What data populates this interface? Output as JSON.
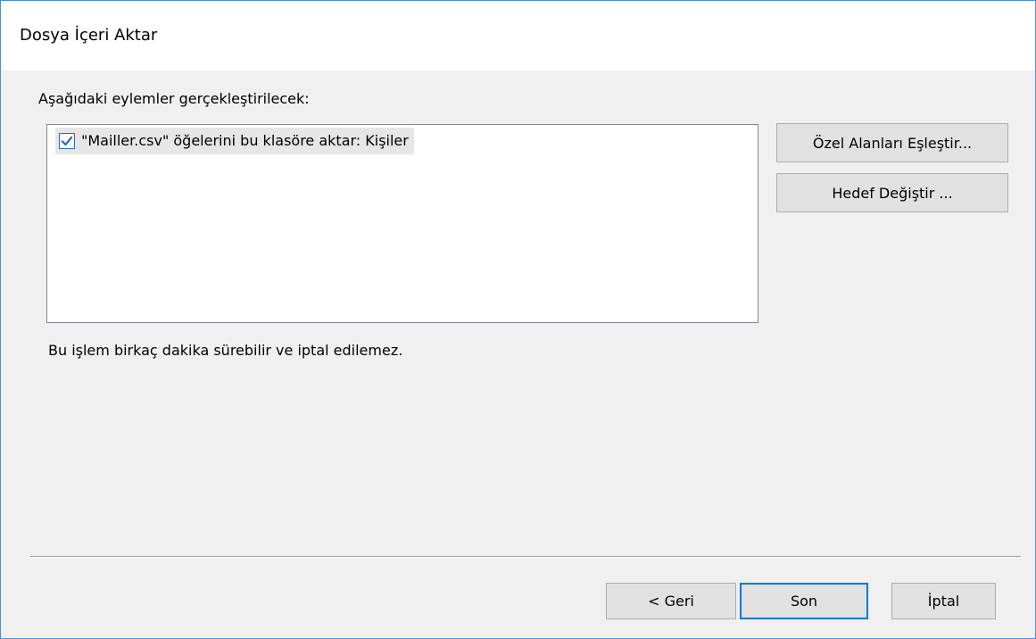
{
  "window": {
    "title": "Dosya İçeri Aktar"
  },
  "actions": {
    "heading": "Aşağıdaki eylemler gerçekleştirilecek:",
    "items": [
      {
        "checked": true,
        "label": "\"Mailler.csv\" öğelerini bu klasöre aktar: Kişiler"
      }
    ]
  },
  "side_buttons": {
    "map_fields_label": "Özel Alanları Eşleştir...",
    "change_target_label": "Hedef Değiştir ..."
  },
  "note": "Bu işlem birkaç dakika sürebilir ve iptal edilemez.",
  "footer": {
    "back_label": "< Geri",
    "finish_label": "Son",
    "cancel_label": "İptal"
  },
  "colors": {
    "accent": "#0078d7",
    "window_border": "#4a8fd6",
    "dialog_background": "#f0f0f0",
    "checkbox_check": "#2b6bbf"
  }
}
